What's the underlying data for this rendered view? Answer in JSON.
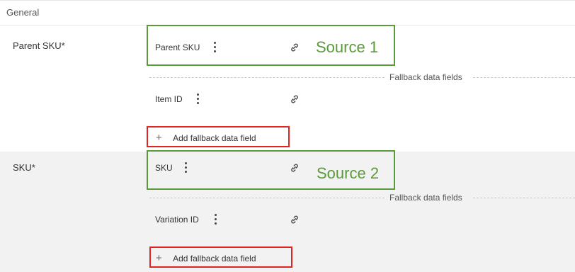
{
  "section": {
    "title": "General"
  },
  "fields": [
    {
      "label": "Parent SKU*",
      "primary": {
        "label": "Parent SKU",
        "icon_menu": "kebab-icon",
        "icon_link": "link-icon"
      },
      "annotation": "Source 1",
      "fallback_caption": "Fallback data fields",
      "fallbacks": [
        {
          "label": "Item ID",
          "icon_menu": "kebab-icon",
          "icon_link": "link-icon"
        }
      ],
      "add_button": {
        "plus": "+",
        "label": "Add fallback data field"
      }
    },
    {
      "label": "SKU*",
      "primary": {
        "label": "SKU",
        "icon_menu": "kebab-icon",
        "icon_link": "link-icon"
      },
      "annotation": "Source 2",
      "fallback_caption": "Fallback data fields",
      "fallbacks": [
        {
          "label": "Variation ID",
          "icon_menu": "kebab-icon",
          "icon_link": "link-icon"
        }
      ],
      "add_button": {
        "plus": "+",
        "label": "Add fallback data field"
      }
    }
  ],
  "colors": {
    "annotation_green": "#5a9a3a",
    "highlight_red": "#e02424",
    "row_alt_bg": "#f2f2f2"
  }
}
